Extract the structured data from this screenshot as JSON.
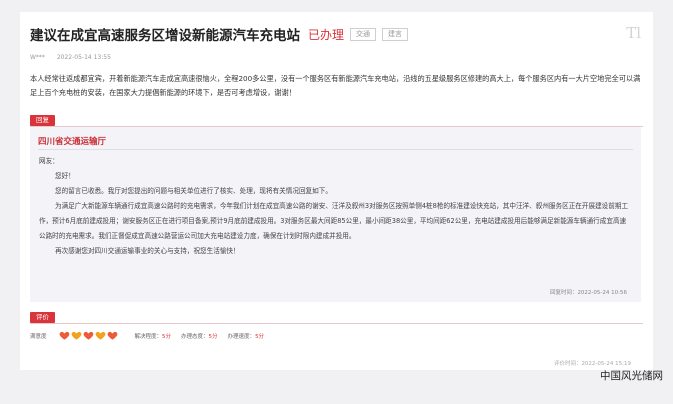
{
  "header": {
    "title": "建议在成宜高速服务区增设新能源汽车充电站",
    "status": "已办理",
    "tags": [
      "交通",
      "建言"
    ]
  },
  "meta": {
    "author": "W***",
    "date": "2022-05-14 13:55"
  },
  "content": "本人经常往返成都宜宾，开着新能源汽车走成宜高速很恼火，全程200多公里，没有一个服务区有新能源汽车充电站，沿线的五星级服务区修建的高大上，每个服务区内有一大片空地完全可以满足上百个充电桩的安装，在国家大力提倡新能源的环境下，是否可考虑增设，谢谢！",
  "reply": {
    "label": "回复",
    "org": "四川省交通运输厅",
    "greeting": "网友：",
    "p1": "您好！",
    "p2": "您的留言已收悉。我厅对您提出的问题与相关单位进行了核实、处理，现将有关情况回复如下。",
    "p3": "为满足广大新能源车辆通行成宜高速公路时的充电需求，今年我们计划在成宜高速公路的谢安、汪洋及叙州3对服务区按照单侧4桩8枪的标准建设快充站，其中汪洋、叙州服务区正在开展建设前期工作，预计6月底前建成投用；谢安服务区正在进行项目备案,预计9月底前建成投用。3对服务区最大间距85公里，最小间距38公里，平均间距62公里，充电站建成投用后能够满足新能源车辆通行成宜高速公路时的充电需求。我们正督促成宜高速公路营运公司加大充电站建设力度，确保在计划时限内建成并投用。",
    "p4": "再次感谢您对四川交通运输事业的关心与支持，祝您生活愉快！",
    "time": "回复时间：2022-05-24 10:56"
  },
  "evaluation": {
    "label": "评价",
    "satisfaction_label": "满意度",
    "rating": 5,
    "max_rating": 5,
    "solve_label": "解决程度：",
    "solve_value": "5分",
    "attitude_label": "办理态度：",
    "attitude_value": "5分",
    "speed_label": "办理速度：",
    "speed_value": "5分",
    "time": "评价时间：2022-05-24 15:19"
  },
  "watermark": "中国风光储网",
  "icons": {
    "ti": "Tl",
    "heart_colors": [
      "#ee5a3a",
      "#f2a21d"
    ]
  }
}
